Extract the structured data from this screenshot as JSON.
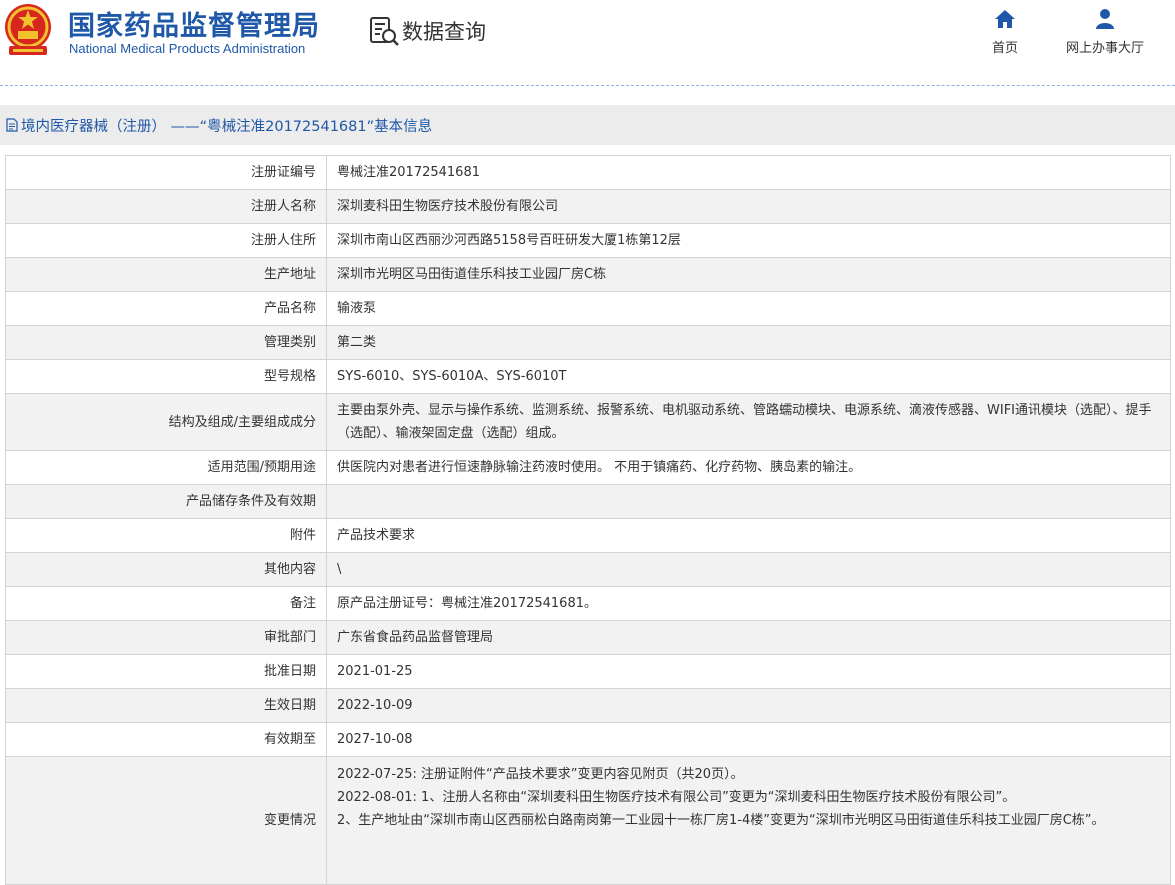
{
  "header": {
    "org_name_cn": "国家药品监督管理局",
    "org_name_en": "National Medical Products Administration",
    "query_label": "数据查询",
    "nav": [
      {
        "label": "首页",
        "icon": "home-icon"
      },
      {
        "label": "网上办事大厅",
        "icon": "user-icon"
      }
    ],
    "accent_color": "#1f58a8"
  },
  "page_title": "境内医疗器械（注册） ——“粤械注准20172541681”基本信息",
  "rows": [
    {
      "label": "注册证编号",
      "value": "粤械注准20172541681"
    },
    {
      "label": "注册人名称",
      "value": "深圳麦科田生物医疗技术股份有限公司"
    },
    {
      "label": "注册人住所",
      "value": "深圳市南山区西丽沙河西路5158号百旺研发大厦1栋第12层"
    },
    {
      "label": "生产地址",
      "value": "深圳市光明区马田街道佳乐科技工业园厂房C栋"
    },
    {
      "label": "产品名称",
      "value": "输液泵"
    },
    {
      "label": "管理类别",
      "value": "第二类"
    },
    {
      "label": "型号规格",
      "value": "SYS-6010、SYS-6010A、SYS-6010T"
    },
    {
      "label": "结构及组成/主要组成成分",
      "value": "主要由泵外壳、显示与操作系统、监测系统、报警系统、电机驱动系统、管路蠕动模块、电源系统、滴液传感器、WIFI通讯模块（选配）、提手（选配）、输液架固定盘（选配）组成。"
    },
    {
      "label": "适用范围/预期用途",
      "value": "供医院内对患者进行恒速静脉输注药液时使用。 不用于镇痛药、化疗药物、胰岛素的输注。"
    },
    {
      "label": "产品储存条件及有效期",
      "value": ""
    },
    {
      "label": "附件",
      "value": "产品技术要求"
    },
    {
      "label": "其他内容",
      "value": "\\"
    },
    {
      "label": "备注",
      "value": "原产品注册证号：粤械注准20172541681。"
    },
    {
      "label": "审批部门",
      "value": "广东省食品药品监督管理局"
    },
    {
      "label": "批准日期",
      "value": "2021-01-25"
    },
    {
      "label": "生效日期",
      "value": "2022-10-09"
    },
    {
      "label": "有效期至",
      "value": "2027-10-08"
    }
  ],
  "changes": {
    "label": "变更情况",
    "lines": [
      "2022-07-25: 注册证附件“产品技术要求”变更内容见附页（共20页）。",
      "2022-08-01: 1、注册人名称由“深圳麦科田生物医疗技术有限公司”变更为“深圳麦科田生物医疗技术股份有限公司”。",
      "2、生产地址由“深圳市南山区西丽松白路南岗第一工业园十一栋厂房1-4楼”变更为“深圳市光明区马田街道佳乐科技工业园厂房C栋”。"
    ]
  }
}
